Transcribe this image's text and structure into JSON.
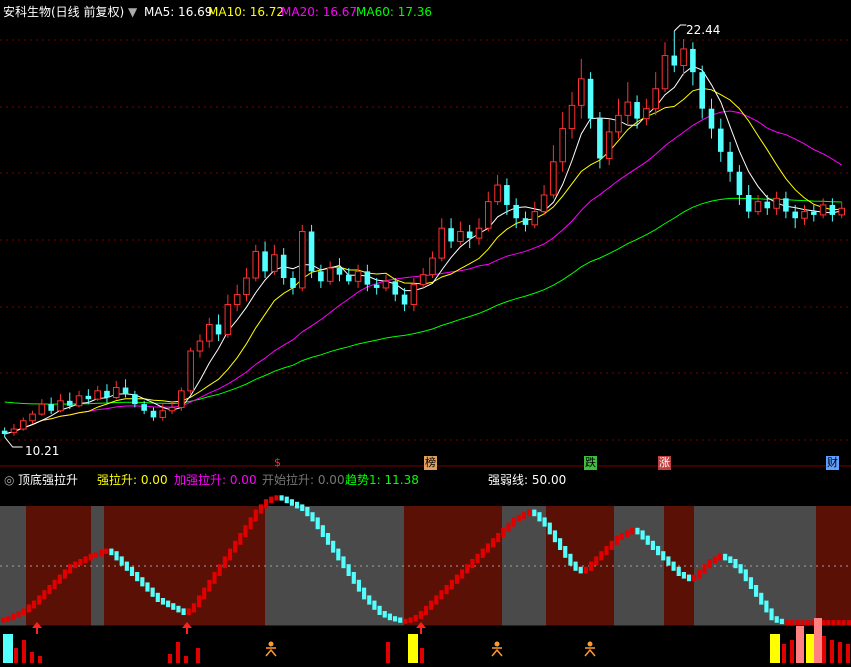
{
  "header": {
    "stock_name": "安科生物(日线 前复权)",
    "ma5": "MA5: 16.69",
    "ma10": "MA10: 16.72",
    "ma20": "MA20: 16.67",
    "ma60": "MA60: 17.36"
  },
  "price_labels": {
    "high": "22.44",
    "low": "10.21"
  },
  "event_markers": [
    "$",
    "榜",
    "跌",
    "涨",
    "财"
  ],
  "indicator": {
    "name": "顶底强拉升",
    "strong_up": "强拉升: 0.00",
    "extra_strong_up": "加强拉升: 0.00",
    "start_up": "开始拉升: 0.00",
    "trend": "趋势1: 11.38",
    "strength_line": "强弱线: 50.00"
  },
  "colors": {
    "ma5": "#ffffff",
    "ma10": "#ffff00",
    "ma20": "#ff00ff",
    "ma60": "#00ff00",
    "up": "#ff3030",
    "down": "#54ffff"
  },
  "chart_data": [
    {
      "type": "candlestick",
      "ylim": [
        10.21,
        22.44
      ],
      "ohlc_note": "approximate, read from visual",
      "candles": [
        [
          10.4,
          10.3,
          10.5,
          10.21
        ],
        [
          10.35,
          10.45,
          10.6,
          10.25
        ],
        [
          10.45,
          10.7,
          10.8,
          10.4
        ],
        [
          10.7,
          10.9,
          11.0,
          10.6
        ],
        [
          10.9,
          11.2,
          11.35,
          10.85
        ],
        [
          11.2,
          11.0,
          11.4,
          10.9
        ],
        [
          11.0,
          11.3,
          11.5,
          10.95
        ],
        [
          11.3,
          11.15,
          11.55,
          11.05
        ],
        [
          11.15,
          11.45,
          11.6,
          11.1
        ],
        [
          11.45,
          11.35,
          11.65,
          11.2
        ],
        [
          11.35,
          11.6,
          11.75,
          11.3
        ],
        [
          11.6,
          11.4,
          11.8,
          11.25
        ],
        [
          11.4,
          11.7,
          11.9,
          11.35
        ],
        [
          11.7,
          11.5,
          11.95,
          11.4
        ],
        [
          11.5,
          11.2,
          11.6,
          11.1
        ],
        [
          11.2,
          11.0,
          11.3,
          10.9
        ],
        [
          11.0,
          10.8,
          11.1,
          10.7
        ],
        [
          10.8,
          11.0,
          11.2,
          10.7
        ],
        [
          11.0,
          11.1,
          11.3,
          10.9
        ],
        [
          11.1,
          11.6,
          11.7,
          11.0
        ],
        [
          11.6,
          12.8,
          12.9,
          11.5
        ],
        [
          12.8,
          13.1,
          13.3,
          12.6
        ],
        [
          13.1,
          13.6,
          13.8,
          12.9
        ],
        [
          13.6,
          13.3,
          13.9,
          13.1
        ],
        [
          13.3,
          14.2,
          14.5,
          13.2
        ],
        [
          14.2,
          14.5,
          14.8,
          14.0
        ],
        [
          14.5,
          15.0,
          15.3,
          14.3
        ],
        [
          15.0,
          15.8,
          16.0,
          14.9
        ],
        [
          15.8,
          15.2,
          16.1,
          15.0
        ],
        [
          15.2,
          15.7,
          16.0,
          15.1
        ],
        [
          15.7,
          15.0,
          15.9,
          14.8
        ],
        [
          15.0,
          14.7,
          15.2,
          14.5
        ],
        [
          14.7,
          16.4,
          16.6,
          14.6
        ],
        [
          16.4,
          15.2,
          16.6,
          15.0
        ],
        [
          15.2,
          14.9,
          15.4,
          14.7
        ],
        [
          14.9,
          15.3,
          15.5,
          14.8
        ],
        [
          15.3,
          15.1,
          15.6,
          14.9
        ],
        [
          15.1,
          14.9,
          15.3,
          14.8
        ],
        [
          14.9,
          15.2,
          15.4,
          14.7
        ],
        [
          15.2,
          14.8,
          15.4,
          14.6
        ],
        [
          14.8,
          14.7,
          15.0,
          14.5
        ],
        [
          14.7,
          14.9,
          15.1,
          14.6
        ],
        [
          14.9,
          14.5,
          15.0,
          14.3
        ],
        [
          14.5,
          14.2,
          14.7,
          14.0
        ],
        [
          14.2,
          14.8,
          15.0,
          14.0
        ],
        [
          14.8,
          15.1,
          15.3,
          14.7
        ],
        [
          15.1,
          15.6,
          15.8,
          15.0
        ],
        [
          15.6,
          16.5,
          16.8,
          15.5
        ],
        [
          16.5,
          16.1,
          16.8,
          15.9
        ],
        [
          16.1,
          16.4,
          16.7,
          16.0
        ],
        [
          16.4,
          16.2,
          16.6,
          15.9
        ],
        [
          16.2,
          16.5,
          16.8,
          16.0
        ],
        [
          16.5,
          17.3,
          17.6,
          16.4
        ],
        [
          17.3,
          17.8,
          18.1,
          17.2
        ],
        [
          17.8,
          17.2,
          18.0,
          16.9
        ],
        [
          17.2,
          16.8,
          17.4,
          16.5
        ],
        [
          16.8,
          16.6,
          17.0,
          16.4
        ],
        [
          16.6,
          17.0,
          17.3,
          16.5
        ],
        [
          17.0,
          17.5,
          17.8,
          16.9
        ],
        [
          17.5,
          18.5,
          19.0,
          17.4
        ],
        [
          18.5,
          19.5,
          20.0,
          18.2
        ],
        [
          19.5,
          20.2,
          20.6,
          19.2
        ],
        [
          20.2,
          21.0,
          21.6,
          19.8
        ],
        [
          21.0,
          19.8,
          21.2,
          19.5
        ],
        [
          19.8,
          18.6,
          20.0,
          18.3
        ],
        [
          18.6,
          19.4,
          19.8,
          18.4
        ],
        [
          19.4,
          19.9,
          20.4,
          19.2
        ],
        [
          19.9,
          20.3,
          20.9,
          19.6
        ],
        [
          20.3,
          19.8,
          20.5,
          19.5
        ],
        [
          19.8,
          20.1,
          20.4,
          19.6
        ],
        [
          20.1,
          20.7,
          21.2,
          19.9
        ],
        [
          20.7,
          21.7,
          22.1,
          20.6
        ],
        [
          21.7,
          21.4,
          22.44,
          21.2
        ],
        [
          21.4,
          21.9,
          22.2,
          21.1
        ],
        [
          21.9,
          21.2,
          22.1,
          20.8
        ],
        [
          21.2,
          20.1,
          21.4,
          19.8
        ],
        [
          20.1,
          19.5,
          20.4,
          19.2
        ],
        [
          19.5,
          18.8,
          19.8,
          18.5
        ],
        [
          18.8,
          18.2,
          19.1,
          17.9
        ],
        [
          18.2,
          17.5,
          18.4,
          17.2
        ],
        [
          17.5,
          17.0,
          17.8,
          16.8
        ],
        [
          17.0,
          17.3,
          17.5,
          16.9
        ],
        [
          17.3,
          17.1,
          17.5,
          16.9
        ],
        [
          17.1,
          17.4,
          17.6,
          16.9
        ],
        [
          17.4,
          17.0,
          17.6,
          16.8
        ],
        [
          17.0,
          16.8,
          17.2,
          16.5
        ],
        [
          16.8,
          17.0,
          17.2,
          16.6
        ],
        [
          17.0,
          16.9,
          17.2,
          16.7
        ],
        [
          16.9,
          17.2,
          17.4,
          16.8
        ],
        [
          17.2,
          16.9,
          17.4,
          16.7
        ],
        [
          16.9,
          17.1,
          17.3,
          16.8
        ]
      ]
    },
    {
      "type": "bar",
      "title": "顶底强拉升",
      "ylim": [
        0,
        100
      ],
      "reference_line": 50,
      "trend_values": [
        5,
        6,
        8,
        10,
        12,
        15,
        18,
        22,
        26,
        30,
        34,
        38,
        42,
        46,
        48,
        50,
        52,
        54,
        55,
        57,
        58,
        56,
        52,
        48,
        44,
        40,
        36,
        32,
        28,
        24,
        20,
        18,
        16,
        14,
        12,
        10,
        12,
        16,
        22,
        28,
        34,
        40,
        46,
        52,
        58,
        64,
        70,
        76,
        82,
        88,
        92,
        96,
        98,
        99,
        98,
        96,
        94,
        92,
        90,
        86,
        82,
        76,
        70,
        64,
        58,
        52,
        46,
        40,
        34,
        28,
        22,
        18,
        14,
        10,
        8,
        6,
        5,
        4,
        4,
        5,
        7,
        10,
        14,
        18,
        22,
        26,
        30,
        34,
        38,
        42,
        46,
        50,
        54,
        58,
        62,
        66,
        70,
        74,
        78,
        82,
        84,
        86,
        88,
        86,
        82,
        78,
        72,
        66,
        60,
        54,
        48,
        44,
        42,
        44,
        48,
        52,
        56,
        60,
        64,
        68,
        70,
        72,
        74,
        72,
        68,
        64,
        60,
        56,
        52,
        48,
        44,
        40,
        38,
        36,
        38,
        42,
        46,
        50,
        52,
        54,
        52,
        50,
        46,
        42,
        36,
        30,
        24,
        18,
        12,
        6,
        4,
        3,
        3,
        3,
        3,
        3,
        3,
        3,
        3,
        3,
        3,
        3,
        3,
        3,
        3
      ]
    }
  ]
}
